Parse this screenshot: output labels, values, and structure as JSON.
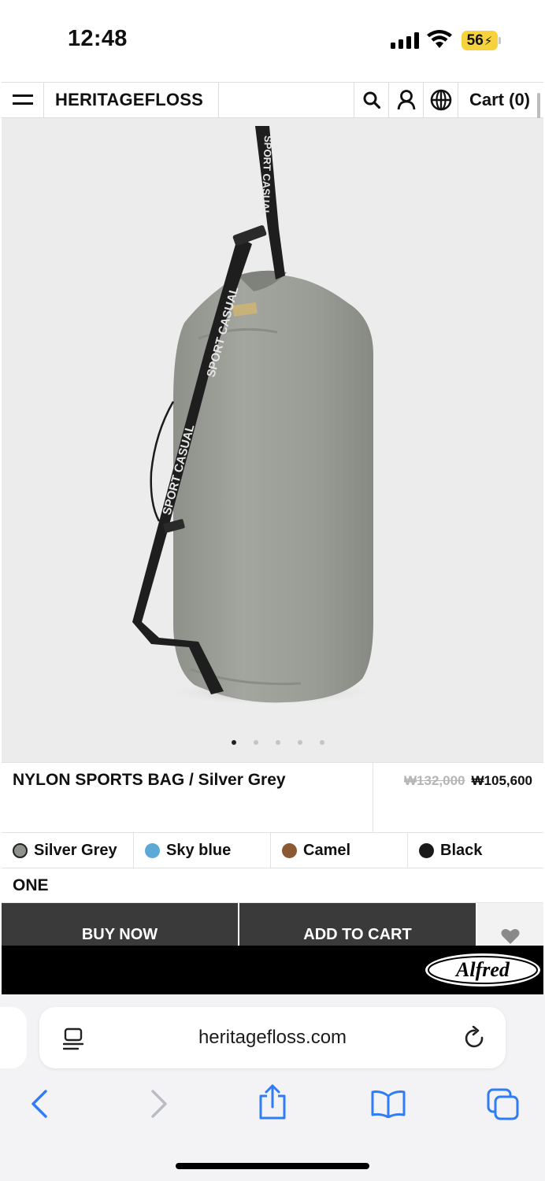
{
  "status_bar": {
    "time": "12:48",
    "battery": "56"
  },
  "header": {
    "brand": "HERITAGEFLOSS",
    "cart_label": "Cart (0)",
    "icons": [
      "menu-icon",
      "search-icon",
      "user-icon",
      "globe-icon"
    ]
  },
  "product": {
    "image_alt": "Grey nylon drawstring sports bag with black SPORT CASUAL strap",
    "strap_text": "SPORT CASUAL",
    "carousel": {
      "count": 5,
      "active": 1
    },
    "title": "NYLON SPORTS BAG / Silver Grey",
    "original_price": "₩132,000",
    "sale_price": "₩105,600",
    "colors": [
      {
        "name": "Silver Grey",
        "swatch": "#8f918b"
      },
      {
        "name": "Sky blue",
        "swatch": "#5aa9d6"
      },
      {
        "name": "Camel",
        "swatch": "#8b5a33"
      },
      {
        "name": "Black",
        "swatch": "#1a1a1a"
      }
    ],
    "size": "ONE",
    "buy_now_label": "BUY NOW",
    "add_to_cart_label": "ADD TO CART"
  },
  "footer_badge": {
    "logo_text": "Alfred"
  },
  "browser": {
    "url": "heritagefloss.com"
  },
  "colors": {
    "button_dark": "#3a3a3a",
    "image_bg": "#ececec",
    "battery": "#f6d33c",
    "safari_blue": "#2f7cf6"
  }
}
